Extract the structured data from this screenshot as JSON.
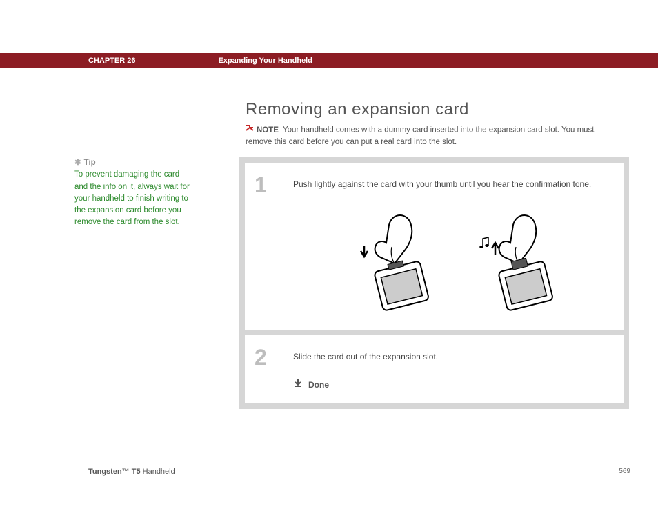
{
  "header": {
    "chapter": "CHAPTER 26",
    "title": "Expanding Your Handheld"
  },
  "page_title": "Removing an expansion card",
  "note": {
    "label": "NOTE",
    "text": "Your handheld comes with a dummy card inserted into the expansion card slot. You must remove this card before you can put a real card into the slot."
  },
  "tip": {
    "label": "Tip",
    "text": "To prevent damaging the card and the info on it, always wait for your handheld to finish writing to the expansion card before you remove the card from the slot."
  },
  "steps": [
    {
      "num": "1",
      "text": "Push lightly against the card with your thumb until you hear the confirmation tone."
    },
    {
      "num": "2",
      "text": "Slide the card out of the expansion slot.",
      "done": "Done"
    }
  ],
  "footer": {
    "product_bold": "Tungsten™ T5",
    "product_rest": " Handheld",
    "page": "569"
  }
}
